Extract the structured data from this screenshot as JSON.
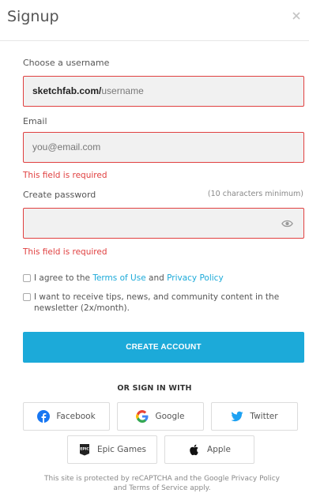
{
  "dialog": {
    "title": "Signup",
    "close_icon": "close-icon"
  },
  "username": {
    "label": "Choose a username",
    "prefix": "sketchfab.com/",
    "placeholder": "username"
  },
  "email": {
    "label": "Email",
    "placeholder": "you@email.com",
    "error": "This field is required"
  },
  "password": {
    "label": "Create password",
    "hint": "(10 characters minimum)",
    "value": "",
    "toggle_icon": "eye-icon",
    "error": "This field is required"
  },
  "terms": {
    "text_before": "I agree to the ",
    "terms_link": "Terms of Use",
    "and": " and ",
    "privacy_link": "Privacy Policy",
    "checked": false
  },
  "newsletter": {
    "text": "I want to receive tips, news, and community content in the newsletter (2x/month).",
    "checked": false
  },
  "create_button": "CREATE ACCOUNT",
  "or_sign_in": "OR SIGN IN WITH",
  "providers": [
    {
      "label": "Facebook",
      "icon": "facebook-icon",
      "color": "#1877f2"
    },
    {
      "label": "Google",
      "icon": "google-icon",
      "color": "#4285f4"
    },
    {
      "label": "Twitter",
      "icon": "twitter-icon",
      "color": "#1da1f2"
    },
    {
      "label": "Epic Games",
      "icon": "epic-games-icon",
      "color": "#222222"
    },
    {
      "label": "Apple",
      "icon": "apple-icon",
      "color": "#111111"
    }
  ],
  "footer": {
    "line1": "This site is protected by reCAPTCHA and the Google Privacy Policy",
    "line2": "and Terms of Service apply."
  },
  "colors": {
    "accent": "#1caad9",
    "error": "#e04040"
  }
}
